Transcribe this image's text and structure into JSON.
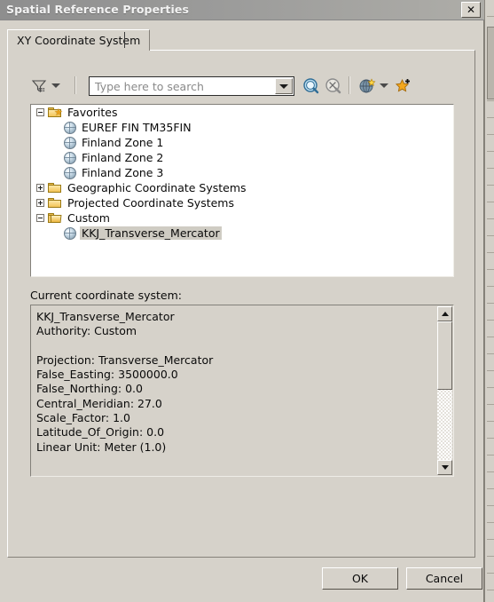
{
  "window": {
    "title": "Spatial Reference Properties",
    "close_label": "✕"
  },
  "tabs": [
    {
      "label": "XY Coordinate System",
      "selected": true
    }
  ],
  "toolbar": {
    "filter_icon": "filter-funnel-icon",
    "filter_dropdown_icon": "chevron-down-icon",
    "search": {
      "value": "",
      "placeholder": "Type here to search",
      "dropdown_icon": "chevron-down-icon"
    },
    "search_button_icon": "magnifier-search-icon",
    "clear_search_button_icon": "magnifier-clear-icon",
    "add_favorite_icon": "globe-star-icon",
    "add_favorite_dropdown_icon": "chevron-down-icon",
    "favorites_star_icon": "star-plus-icon"
  },
  "tree": {
    "nodes": [
      {
        "label": "Favorites",
        "icon": "favorites-folder-icon",
        "expander": "minus",
        "depth": 0,
        "selected": false
      },
      {
        "label": "EUREF FIN TM35FIN",
        "icon": "globe-icon",
        "expander": "none",
        "depth": 1,
        "selected": false
      },
      {
        "label": "Finland Zone 1",
        "icon": "globe-icon",
        "expander": "none",
        "depth": 1,
        "selected": false
      },
      {
        "label": "Finland Zone 2",
        "icon": "globe-icon",
        "expander": "none",
        "depth": 1,
        "selected": false
      },
      {
        "label": "Finland Zone 3",
        "icon": "globe-icon",
        "expander": "none",
        "depth": 1,
        "selected": false
      },
      {
        "label": "Geographic Coordinate Systems",
        "icon": "folder-icon",
        "expander": "plus",
        "depth": 0,
        "selected": false
      },
      {
        "label": "Projected Coordinate Systems",
        "icon": "folder-icon",
        "expander": "plus",
        "depth": 0,
        "selected": false
      },
      {
        "label": "Custom",
        "icon": "folder-open-icon",
        "expander": "minus",
        "depth": 0,
        "selected": false
      },
      {
        "label": "KKJ_Transverse_Mercator",
        "icon": "globe-icon",
        "expander": "none",
        "depth": 1,
        "selected": true
      }
    ]
  },
  "current_coordinate_system": {
    "label": "Current coordinate system:",
    "text": "KKJ_Transverse_Mercator\nAuthority: Custom\n\nProjection: Transverse_Mercator\nFalse_Easting: 3500000.0\nFalse_Northing: 0.0\nCentral_Meridian: 27.0\nScale_Factor: 1.0\nLatitude_Of_Origin: 0.0\nLinear Unit: Meter (1.0)",
    "scrollbar": {
      "up_icon": "triangle-up-icon",
      "down_icon": "triangle-down-icon"
    }
  },
  "buttons": {
    "ok": "OK",
    "cancel": "Cancel"
  },
  "colors": {
    "dialog_background": "#d6d2ca",
    "titlebar_start": "#8e8e8e",
    "titlebar_end": "#aeada8",
    "tree_background": "#ffffff",
    "selection": "#cfccc3",
    "text": "#0a0a0a",
    "placeholder": "#8a8a8a"
  }
}
